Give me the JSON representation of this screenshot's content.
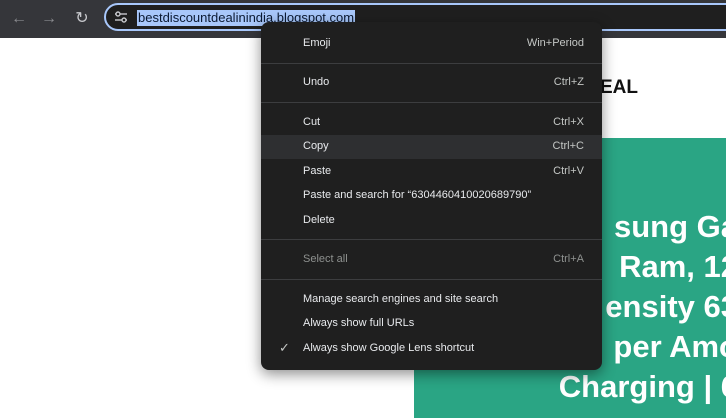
{
  "toolbar": {
    "back_icon": "arrow-left-icon",
    "forward_icon": "arrow-right-icon",
    "reload_icon": "reload-icon",
    "site_info_icon": "tune-icon",
    "url": "bestdiscountdealinindia.blogspot.com"
  },
  "page": {
    "heading_fragment": "EAL",
    "banner_lines": [
      "sung Ga",
      "Ram, 12",
      "ensity 63",
      "per Amo",
      "Charging | 6"
    ]
  },
  "menu": {
    "emoji": {
      "label": "Emoji",
      "shortcut": "Win+Period"
    },
    "undo": {
      "label": "Undo",
      "shortcut": "Ctrl+Z"
    },
    "cut": {
      "label": "Cut",
      "shortcut": "Ctrl+X"
    },
    "copy": {
      "label": "Copy",
      "shortcut": "Ctrl+C"
    },
    "paste": {
      "label": "Paste",
      "shortcut": "Ctrl+V"
    },
    "paste_search": {
      "label": "Paste and search for “6304460410020689790”"
    },
    "delete": {
      "label": "Delete"
    },
    "select_all": {
      "label": "Select all",
      "shortcut": "Ctrl+A"
    },
    "manage_search": {
      "label": "Manage search engines and site search"
    },
    "show_full_urls": {
      "label": "Always show full URLs"
    },
    "show_lens": {
      "label": "Always show Google Lens shortcut",
      "checked_glyph": "✓"
    }
  },
  "colors": {
    "toolbar_bg": "#35363a",
    "menu_bg": "#1f1f1f",
    "url_highlight": "#a8c7fa",
    "banner_green": "#2aa584"
  }
}
